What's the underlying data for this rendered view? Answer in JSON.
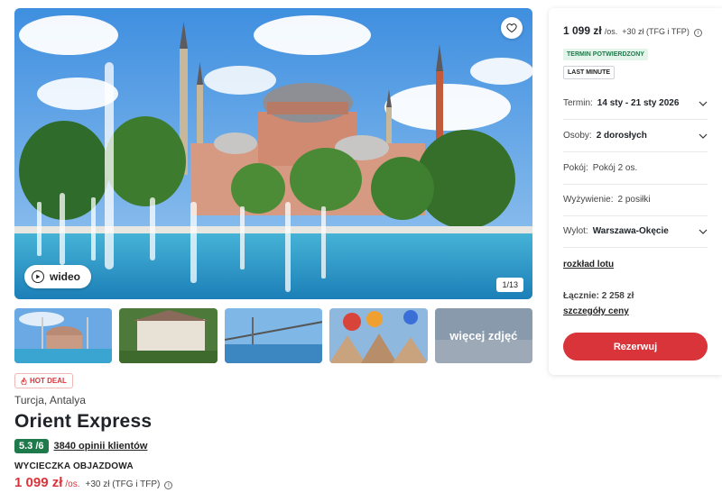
{
  "gallery": {
    "video_label": "wideo",
    "counter": "1/13",
    "more_photos_label": "więcej zdjęć",
    "icons": [
      "heart-icon",
      "play-icon"
    ]
  },
  "offer": {
    "hot_deal": "HOT DEAL",
    "destination": "Turcja, Antalya",
    "title": "Orient Express",
    "rating": "5.3 /6",
    "reviews": "3840 opinii klientów",
    "trip_type": "WYCIECZKA OBJAZDOWA",
    "price": "1 099 zł",
    "per_person": "/os.",
    "extra_fees": "+30 zł (TFG i TFP)"
  },
  "booking": {
    "price": "1 099 zł",
    "per_person": "/os.",
    "extra_fees": "+30 zł (TFG i TFP)",
    "badge_confirmed": "TERMIN POTWIERDZONY",
    "badge_last_minute": "LAST MINUTE",
    "term_label": "Termin:",
    "term_value": "14 sty - 21 sty 2026",
    "persons_label": "Osoby:",
    "persons_value": "2 dorosłych",
    "room_label": "Pokój:",
    "room_value": "Pokój 2 os.",
    "food_label": "Wyżywienie:",
    "food_value": "2 posiłki",
    "departure_label": "Wylot:",
    "departure_value": "Warszawa-Okęcie",
    "flight_schedule": "rozkład lotu",
    "total": "Łącznie: 2 258 zł",
    "price_details": "szczegóły ceny",
    "reserve_button": "Rezerwuj"
  },
  "colors": {
    "accent_red": "#d9343a",
    "rating_green": "#1f7a4b",
    "badge_green_bg": "#e3f4ea"
  }
}
